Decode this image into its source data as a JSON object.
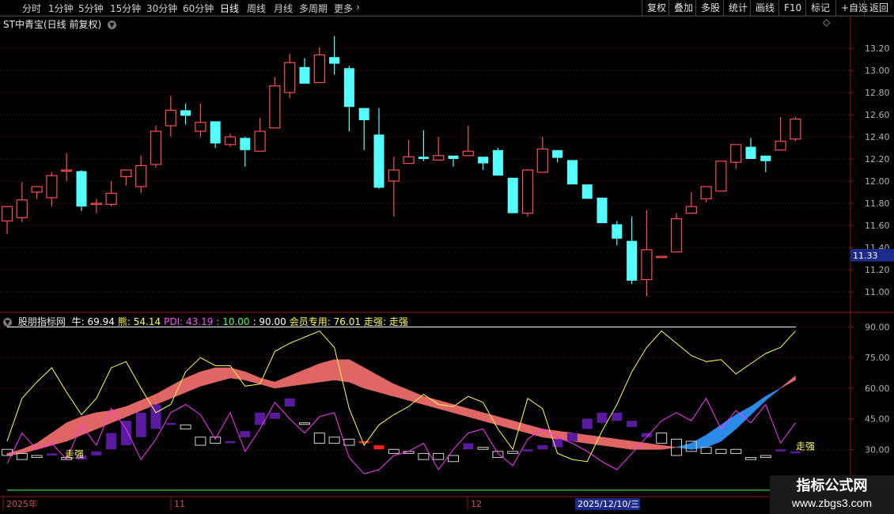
{
  "toolbar": {
    "periods": [
      "分时",
      "1分钟",
      "5分钟",
      "15分钟",
      "30分钟",
      "60分钟",
      "日线",
      "周线",
      "月线",
      "多周期",
      "更多"
    ],
    "active_period": "日线",
    "more_icon": "chevron-right-icon",
    "right_buttons": [
      "复权",
      "叠加",
      "多股",
      "统计",
      "画线",
      "F10",
      "标记",
      "+自选",
      "返回"
    ]
  },
  "main_panel": {
    "title": "ST中青宝(日线 前复权)",
    "menu_icon": "chevron-down-circle-icon",
    "diamond_icon": "diamond-icon",
    "up_color": "#ff4d4d",
    "down_color": "#54ffff",
    "price_tag": "11.33"
  },
  "indicator_panel": {
    "menu_icon": "chevron-down-circle-icon",
    "name": "股朋指标网",
    "fields": [
      {
        "label": "牛:",
        "value": "69.94",
        "color": "#ffffff"
      },
      {
        "label": "熊:",
        "value": "54.14",
        "color": "#ffff4d"
      },
      {
        "label": "PDI:",
        "value": "43.19",
        "color": "#ff4dff"
      },
      {
        "label": ":",
        "value": "10.00",
        "color": "#4dff4d"
      },
      {
        "label": ":",
        "value": "90.00",
        "color": "#ffffff"
      },
      {
        "label": "会员专用:",
        "value": "76.01",
        "color": "#ffff4d"
      },
      {
        "label": "走强:",
        "value": "走强",
        "color": "#ffff4d"
      }
    ],
    "zouqiang_label": "走强"
  },
  "date_axis": {
    "labels": [
      "2025年",
      "11",
      "12"
    ],
    "cursor_date": "2025/12/10/三"
  },
  "watermark": {
    "name": "指标公式网",
    "url": "www.zbgs3.com"
  },
  "chart_data": [
    {
      "type": "candlestick",
      "title": "ST中青宝(日线 前复权)",
      "ylim": [
        10.85,
        13.35
      ],
      "yticks": [
        "13.20",
        "13.00",
        "12.80",
        "12.60",
        "12.40",
        "12.20",
        "12.00",
        "11.80",
        "11.60",
        "11.40",
        "11.20",
        "11.00"
      ],
      "grid": true,
      "candles": [
        [
          11.64,
          11.77,
          11.52,
          11.75
        ],
        [
          11.67,
          11.83,
          11.63,
          11.99
        ],
        [
          11.9,
          11.95,
          11.84,
          11.86
        ],
        [
          11.85,
          12.05,
          12.08,
          11.77
        ],
        [
          12.09,
          12.1,
          12.25,
          12.0
        ],
        [
          12.09,
          11.77,
          12.1,
          11.73
        ],
        [
          11.79,
          11.8,
          11.84,
          11.71
        ],
        [
          11.79,
          11.89,
          12.0,
          11.77
        ],
        [
          12.04,
          12.1,
          12.1,
          11.96
        ],
        [
          11.95,
          12.14,
          12.23,
          11.89
        ],
        [
          12.15,
          12.45,
          12.5,
          12.12
        ],
        [
          12.5,
          12.64,
          12.77,
          12.4
        ],
        [
          12.64,
          12.59,
          12.7,
          12.51
        ],
        [
          12.45,
          12.53,
          12.7,
          12.4
        ],
        [
          12.54,
          12.34,
          12.54,
          12.3
        ],
        [
          12.33,
          12.4,
          12.43,
          12.31
        ],
        [
          12.39,
          12.28,
          12.4,
          12.13
        ],
        [
          12.27,
          12.45,
          12.57,
          12.27
        ],
        [
          12.48,
          12.86,
          12.94,
          12.48
        ],
        [
          12.8,
          13.07,
          13.15,
          12.75
        ],
        [
          13.03,
          12.88,
          13.11,
          12.88
        ],
        [
          12.89,
          13.14,
          13.21,
          12.89
        ],
        [
          13.12,
          13.06,
          13.31,
          12.96
        ],
        [
          13.02,
          12.67,
          13.04,
          12.45
        ],
        [
          12.66,
          12.55,
          12.66,
          12.28
        ],
        [
          12.42,
          11.94,
          12.66,
          11.93
        ],
        [
          12.0,
          12.1,
          12.22,
          11.68
        ],
        [
          12.16,
          12.22,
          12.37,
          12.16
        ],
        [
          12.22,
          12.2,
          12.46,
          12.18
        ],
        [
          12.19,
          12.23,
          12.4,
          12.19
        ],
        [
          12.23,
          12.2,
          12.23,
          12.13
        ],
        [
          12.23,
          12.27,
          12.5,
          12.23
        ],
        [
          12.22,
          12.16,
          12.22,
          12.1
        ],
        [
          12.28,
          12.05,
          12.3,
          12.05
        ],
        [
          12.03,
          11.71,
          12.03,
          11.71
        ],
        [
          11.71,
          12.1,
          12.11,
          11.68
        ],
        [
          12.08,
          12.29,
          12.4,
          12.08
        ],
        [
          12.28,
          12.21,
          12.28,
          12.17
        ],
        [
          12.19,
          11.97,
          12.19,
          11.97
        ],
        [
          11.97,
          11.84,
          11.97,
          11.84
        ],
        [
          11.85,
          11.62,
          11.85,
          11.62
        ],
        [
          11.61,
          11.48,
          11.64,
          11.42
        ],
        [
          11.46,
          11.1,
          11.68,
          11.07
        ],
        [
          11.11,
          11.38,
          11.74,
          10.96
        ],
        [
          11.31,
          11.32,
          11.32,
          11.31
        ],
        [
          11.36,
          11.66,
          11.71,
          11.36
        ],
        [
          11.71,
          11.77,
          11.9,
          11.71
        ],
        [
          11.84,
          11.95,
          11.95,
          11.81
        ],
        [
          11.91,
          12.18,
          12.18,
          11.91
        ],
        [
          12.17,
          12.33,
          12.33,
          12.11
        ],
        [
          12.31,
          12.2,
          12.39,
          12.2
        ],
        [
          12.23,
          12.18,
          12.23,
          12.08
        ],
        [
          12.28,
          12.36,
          12.58,
          12.32
        ],
        [
          12.38,
          12.56,
          12.58,
          12.36
        ]
      ],
      "candle_fields": [
        "open",
        "close",
        "high",
        "low"
      ]
    },
    {
      "type": "line",
      "ylim": [
        8,
        96
      ],
      "yticks": [
        "90.00",
        "75.00",
        "60.00",
        "45.00",
        "30.00"
      ],
      "grid": true,
      "x": [
        0,
        1,
        2,
        3,
        4,
        5,
        6,
        7,
        8,
        9,
        10,
        11,
        12,
        13,
        14,
        15,
        16,
        17,
        18,
        19,
        20,
        21,
        22,
        23,
        24,
        25,
        26,
        27,
        28,
        29,
        30,
        31,
        32,
        33,
        34,
        35,
        36,
        37,
        38,
        39,
        40,
        41,
        42,
        43,
        44,
        45,
        46,
        47,
        48,
        49,
        50,
        51,
        52,
        53
      ],
      "series": [
        {
          "name": "牛",
          "color": "#ff6666",
          "values": [
            28,
            30,
            33,
            38,
            43,
            46,
            48,
            49,
            51,
            54,
            57,
            61,
            65,
            68,
            70,
            70,
            68,
            65,
            63,
            66,
            69,
            72,
            74,
            74,
            70,
            66,
            62,
            59,
            56,
            54,
            52,
            50,
            48,
            46,
            44,
            42,
            40,
            39,
            38,
            37,
            36,
            35,
            34,
            33,
            32,
            31,
            30,
            31,
            34,
            40,
            47,
            54,
            60,
            66
          ]
        },
        {
          "name": "熊",
          "color": "#ffff66",
          "values": [
            27,
            28,
            30,
            32,
            34,
            37,
            40,
            43,
            46,
            49,
            52,
            55,
            58,
            61,
            63,
            65,
            64,
            62,
            60,
            61,
            62,
            63,
            64,
            63,
            60,
            58,
            56,
            54,
            52,
            50,
            48,
            46,
            44,
            42,
            40,
            38,
            36,
            35,
            34,
            33,
            32,
            31,
            30,
            30,
            30,
            31,
            33,
            37,
            42,
            47,
            51,
            56,
            60,
            64
          ]
        },
        {
          "name": "会员专用",
          "color": "#ffff4d",
          "values": [
            34,
            55,
            63,
            70,
            58,
            47,
            55,
            70,
            73,
            60,
            48,
            52,
            68,
            75,
            71,
            71,
            61,
            62,
            78,
            82,
            85,
            88,
            80,
            50,
            32,
            42,
            47,
            51,
            57,
            52,
            51,
            56,
            53,
            40,
            30,
            55,
            50,
            28,
            25,
            24,
            39,
            52,
            68,
            80,
            88,
            82,
            76,
            73,
            74,
            67,
            72,
            77,
            80,
            88
          ]
        },
        {
          "name": "PDI",
          "color": "#ff33ff",
          "values": [
            23,
            38,
            30,
            33,
            25,
            42,
            32,
            50,
            40,
            25,
            35,
            48,
            52,
            47,
            35,
            48,
            29,
            40,
            53,
            45,
            38,
            46,
            48,
            26,
            18,
            20,
            27,
            29,
            33,
            20,
            30,
            38,
            40,
            28,
            22,
            35,
            40,
            36,
            33,
            29,
            24,
            20,
            28,
            36,
            44,
            48,
            44,
            55,
            40,
            49,
            43,
            52,
            33,
            43
          ]
        },
        {
          "name": "走强",
          "color": "#ffff66",
          "values": [
            10,
            10,
            10,
            10,
            10,
            10,
            10,
            10,
            10,
            10,
            10,
            10,
            10,
            10,
            10,
            10,
            10,
            10,
            10,
            10,
            10,
            10,
            10,
            10,
            10,
            10,
            10,
            10,
            10,
            10,
            10,
            10,
            10,
            10,
            10,
            10,
            10,
            10,
            10,
            10,
            10,
            10,
            10,
            10,
            10,
            10,
            10,
            10,
            10,
            10,
            10,
            10,
            10,
            10
          ]
        }
      ],
      "reference_lines": [
        {
          "value": 90,
          "color": "#ffffff"
        },
        {
          "value": 10,
          "color": "#4dff4d"
        }
      ],
      "bars": [
        [
          30,
          27,
          "w"
        ],
        [
          28,
          25,
          "w"
        ],
        [
          27,
          26,
          "w"
        ],
        [
          27,
          28,
          "p"
        ],
        [
          26,
          25,
          "w"
        ],
        [
          25,
          27,
          "p"
        ],
        [
          27,
          29,
          "p"
        ],
        [
          30,
          38,
          "p"
        ],
        [
          32,
          44,
          "p"
        ],
        [
          36,
          48,
          "p"
        ],
        [
          40,
          52,
          "p"
        ],
        [
          42,
          43,
          "p"
        ],
        [
          42,
          40,
          "w"
        ],
        [
          36,
          32,
          "w"
        ],
        [
          36,
          33,
          "w"
        ],
        [
          34,
          33,
          "p"
        ],
        [
          36,
          39,
          "p"
        ],
        [
          42,
          48,
          "p"
        ],
        [
          45,
          48,
          "p"
        ],
        [
          51,
          55,
          "p"
        ],
        [
          43,
          43,
          "w"
        ],
        [
          38,
          33,
          "w"
        ],
        [
          36,
          33,
          "w"
        ],
        [
          32,
          35,
          "w"
        ],
        [
          33,
          34,
          "r"
        ],
        [
          30,
          32,
          "r"
        ],
        [
          28,
          30,
          "w"
        ],
        [
          29,
          28,
          "w"
        ],
        [
          25,
          28,
          "w"
        ],
        [
          25,
          28,
          "w"
        ],
        [
          24,
          27,
          "w"
        ],
        [
          30,
          33,
          "p"
        ],
        [
          30,
          31,
          "w"
        ],
        [
          26,
          29,
          "w"
        ],
        [
          29,
          28,
          "w"
        ],
        [
          29,
          30,
          "p"
        ],
        [
          30,
          32,
          "p"
        ],
        [
          31,
          35,
          "p"
        ],
        [
          34,
          38,
          "p"
        ],
        [
          40,
          45,
          "p"
        ],
        [
          43,
          48,
          "p"
        ],
        [
          44,
          48,
          "p"
        ],
        [
          41,
          44,
          "p"
        ],
        [
          36,
          38,
          "p"
        ],
        [
          38,
          33,
          "w"
        ],
        [
          35,
          27,
          "w"
        ],
        [
          34,
          29,
          "w"
        ],
        [
          31,
          28,
          "w"
        ],
        [
          30,
          28,
          "w"
        ],
        [
          28,
          30,
          "w"
        ],
        [
          26,
          25,
          "w"
        ],
        [
          26,
          27,
          "w"
        ],
        [
          29,
          30,
          "p"
        ],
        [
          28,
          29,
          "p"
        ]
      ]
    }
  ]
}
